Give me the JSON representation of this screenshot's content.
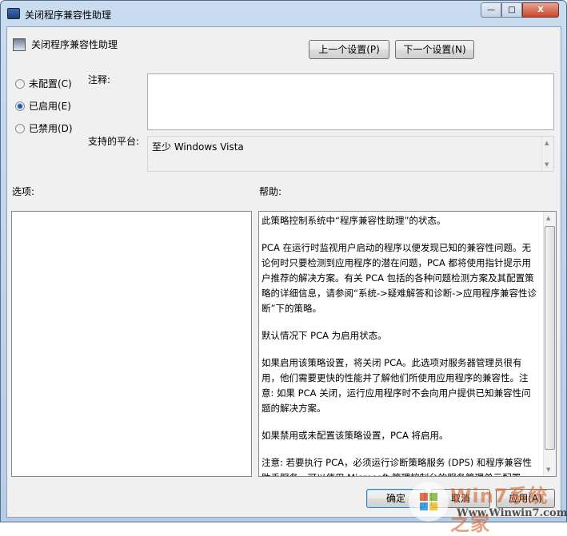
{
  "window": {
    "title": "关闭程序兼容性助理",
    "minimize": "—",
    "maximize": "□",
    "close": "X"
  },
  "header": {
    "policy_name": "关闭程序兼容性助理",
    "prev_button": "上一个设置(P)",
    "next_button": "下一个设置(N)"
  },
  "state": {
    "options": [
      {
        "label": "未配置(C)",
        "checked": false
      },
      {
        "label": "已启用(E)",
        "checked": true
      },
      {
        "label": "已禁用(D)",
        "checked": false
      }
    ]
  },
  "comment": {
    "label": "注释:",
    "value": ""
  },
  "platform": {
    "label": "支持的平台:",
    "value": "至少 Windows Vista"
  },
  "options_label": "选项:",
  "help_label": "帮助:",
  "help_paragraphs": [
    "此策略控制系统中“程序兼容性助理”的状态。",
    "PCA 在运行时监视用户启动的程序以便发现已知的兼容性问题。无论何时只要检测到应用程序的潜在问题，PCA 都将使用指针提示用户推荐的解决方案。有关 PCA 包括的各种问题检测方案及其配置策略的详细信息，请参阅“系统->疑难解答和诊断->应用程序兼容性诊断”下的策略。",
    "默认情况下 PCA 为启用状态。",
    "如果启用该策略设置，将关闭 PCA。此选项对服务器管理员很有用，他们需要更快的性能并了解他们所使用应用程序的兼容性。注意: 如果 PCA 关闭，运行应用程序时不会向用户提供已知兼容性问题的解决方案。",
    "如果禁用或未配置该策略设置，PCA 将启用。",
    "注意: 若要执行 PCA，必须运行诊断策略服务 (DPS) 和程序兼容性助手服务。可以使用 Microsoft 管理控制台的服务管理单元配置"
  ],
  "footer": {
    "ok": "确定",
    "cancel": "取消",
    "apply": "应用(A)"
  },
  "watermark": {
    "brand": "Win7系统之家",
    "url": "Www.Winwin7.com"
  }
}
